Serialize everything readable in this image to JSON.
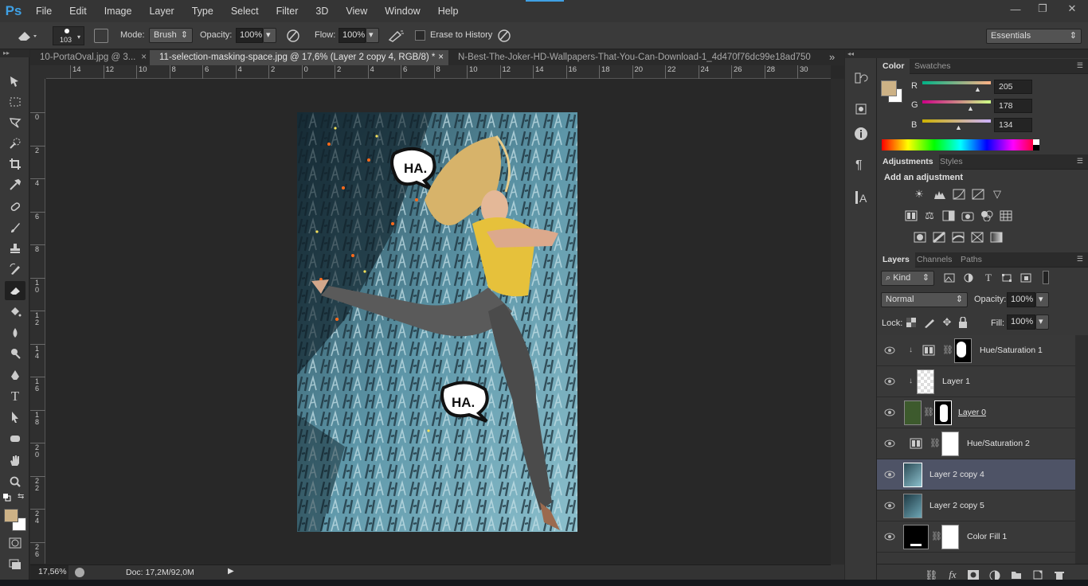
{
  "app": {
    "logo": "Ps"
  },
  "menu": [
    "File",
    "Edit",
    "Image",
    "Layer",
    "Type",
    "Select",
    "Filter",
    "3D",
    "View",
    "Window",
    "Help"
  ],
  "window_controls": {
    "minimize": "—",
    "restore": "❐",
    "close": "✕"
  },
  "options": {
    "brush_size": "103",
    "mode_label": "Mode:",
    "mode_value": "Brush",
    "opacity_label": "Opacity:",
    "opacity_value": "100%",
    "flow_label": "Flow:",
    "flow_value": "100%",
    "erase_history_label": "Erase to History",
    "workspace": "Essentials"
  },
  "tabs": [
    {
      "label": "10-PortaOval.jpg @ 3...",
      "close": "×"
    },
    {
      "label": "11-selection-masking-space.jpg @ 17,6% (Layer 2 copy 4, RGB/8) *",
      "close": "×"
    },
    {
      "label": "N-Best-The-Joker-HD-Wallpapers-That-You-Can-Download-1_4d470f76dc99e18ad750"
    }
  ],
  "tabs_overflow": "»",
  "ruler_top": [
    "14",
    "12",
    "10",
    "8",
    "6",
    "4",
    "2",
    "0",
    "2",
    "4",
    "6",
    "8",
    "10",
    "12",
    "14",
    "16",
    "18",
    "20",
    "22",
    "24",
    "26",
    "28",
    "30"
  ],
  "ruler_left": [
    "0",
    "2",
    "4",
    "6",
    "8",
    "1\n0",
    "1\n2",
    "1\n4",
    "1\n6",
    "1\n8",
    "2\n0",
    "2\n2",
    "2\n4",
    "2\n6"
  ],
  "canvas": {
    "bubble1": "HA.",
    "bubble2": "HA."
  },
  "status": {
    "zoom": "17,56%",
    "doc": "Doc: 17,2M/92,0M"
  },
  "color_panel": {
    "tabs": [
      "Color",
      "Swatches"
    ],
    "r_label": "R",
    "r_value": "205",
    "g_label": "G",
    "g_value": "178",
    "b_label": "B",
    "b_value": "134",
    "foreground": "#cdb286",
    "background": "#ffffff"
  },
  "adjustments_panel": {
    "tabs": [
      "Adjustments",
      "Styles"
    ],
    "heading": "Add an adjustment"
  },
  "layers_panel": {
    "tabs": [
      "Layers",
      "Channels",
      "Paths"
    ],
    "kind_label": "Kind",
    "blend_mode": "Normal",
    "opacity_label": "Opacity:",
    "opacity_value": "100%",
    "lock_label": "Lock:",
    "fill_label": "Fill:",
    "fill_value": "100%",
    "layers": [
      {
        "name": "Hue/Saturation 1"
      },
      {
        "name": "Layer 1"
      },
      {
        "name": "Layer 0"
      },
      {
        "name": "Hue/Saturation 2"
      },
      {
        "name": "Layer 2 copy 4"
      },
      {
        "name": "Layer 2 copy 5"
      },
      {
        "name": "Color Fill 1"
      }
    ]
  }
}
